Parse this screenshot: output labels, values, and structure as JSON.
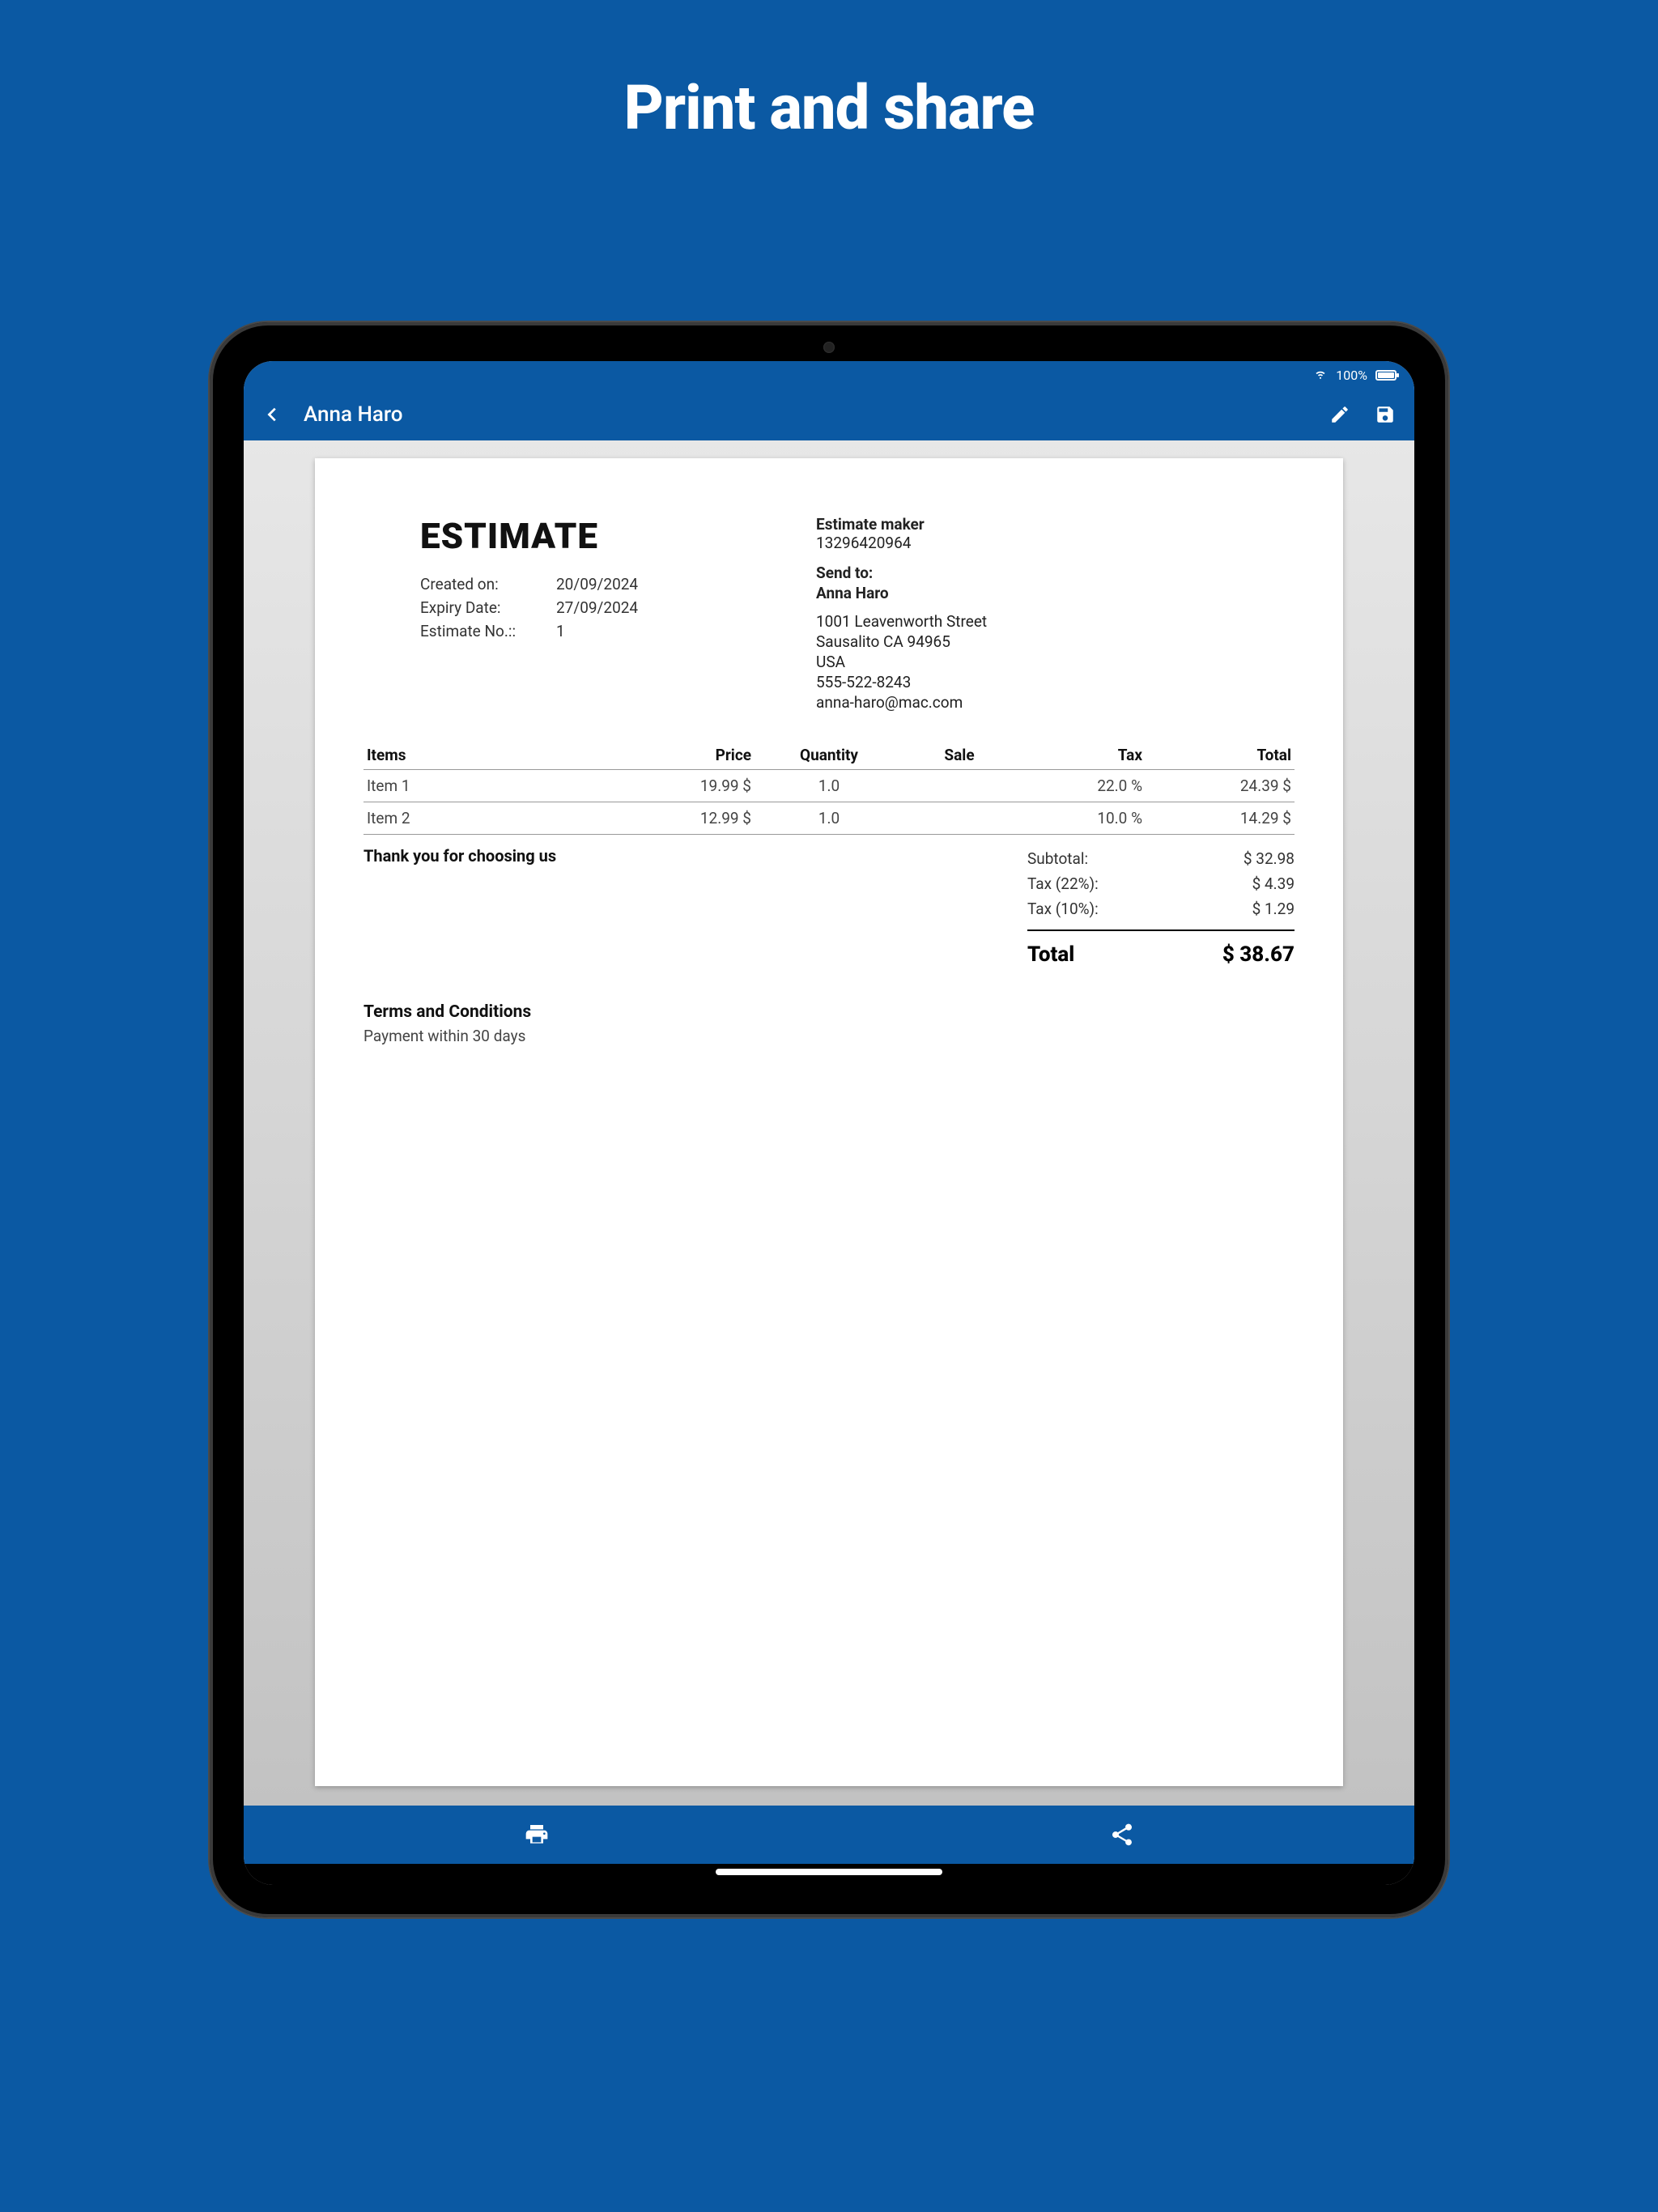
{
  "promo": {
    "title": "Print and share"
  },
  "statusbar": {
    "battery_pct": "100%"
  },
  "appbar": {
    "title": "Anna Haro"
  },
  "document": {
    "title": "ESTIMATE",
    "meta": {
      "created_label": "Created on:",
      "created_value": "20/09/2024",
      "expiry_label": "Expiry Date:",
      "expiry_value": "27/09/2024",
      "number_label": "Estimate No.::",
      "number_value": "1"
    },
    "sender": {
      "name": "Estimate maker",
      "id": "13296420964"
    },
    "send_to": {
      "label": "Send to:",
      "name": "Anna Haro",
      "addr1": "1001  Leavenworth Street",
      "addr2": "Sausalito CA 94965",
      "country": "USA",
      "phone": "555-522-8243",
      "email": "anna-haro@mac.com"
    },
    "columns": {
      "items": "Items",
      "price": "Price",
      "qty": "Quantity",
      "sale": "Sale",
      "tax": "Tax",
      "total": "Total"
    },
    "rows": [
      {
        "name": "Item 1",
        "price": "19.99 $",
        "qty": "1.0",
        "sale": "",
        "tax": "22.0 %",
        "total": "24.39 $"
      },
      {
        "name": "Item 2",
        "price": "12.99 $",
        "qty": "1.0",
        "sale": "",
        "tax": "10.0 %",
        "total": "14.29 $"
      }
    ],
    "thanks": "Thank you for choosing us",
    "summary": {
      "subtotal_label": "Subtotal:",
      "subtotal_value": "$ 32.98",
      "tax1_label": "Tax (22%):",
      "tax1_value": "$ 4.39",
      "tax2_label": "Tax (10%):",
      "tax2_value": "$ 1.29",
      "total_label": "Total",
      "total_value": "$ 38.67"
    },
    "terms": {
      "title": "Terms and Conditions",
      "body": "Payment within 30 days"
    }
  }
}
